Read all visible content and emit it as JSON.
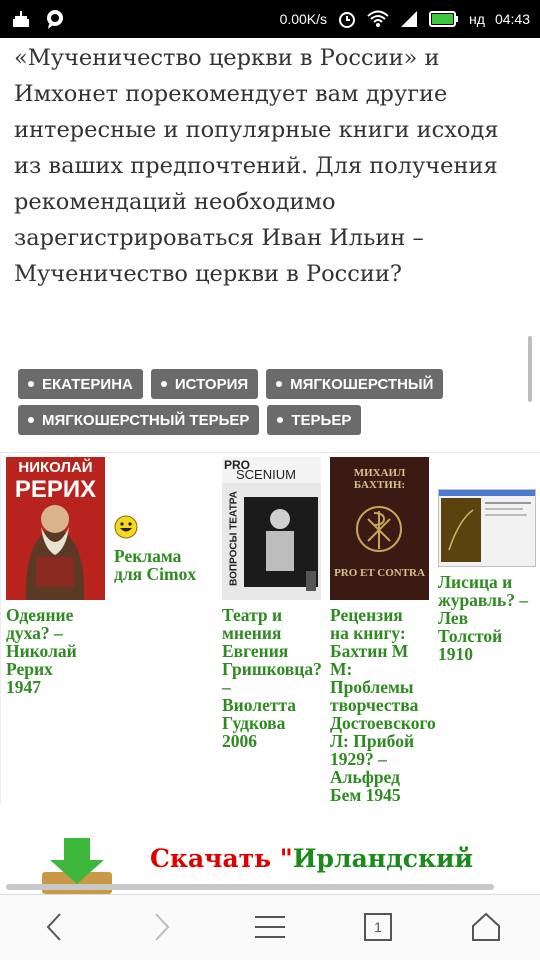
{
  "status_bar": {
    "speed": "0.00K/s",
    "day": "нд",
    "time": "04:43"
  },
  "article": {
    "lines": [
      "«Мученичество церкви в России» и",
      "Имхонет порекомендует вам другие",
      "интересные и популярные книги исходя",
      "из ваших предпочтений. Для получения",
      "рекомендаций необходимо",
      "зарегистрироваться Иван Ильин –",
      "Мученичество церкви в России?"
    ]
  },
  "tags": [
    "ЕКАТЕРИНА",
    "ИСТОРИЯ",
    "МЯГКОШЕРСТНЫЙ",
    "МЯГКОШЕРСТНЫЙ ТЕРЬЕР",
    "ТЕРЬЕР"
  ],
  "books": [
    {
      "title_lines": [
        "Одеяние",
        "духа? –",
        "Николай",
        "Рерих",
        "1947"
      ],
      "cover_text": [
        "НИКОЛАЙ",
        "РЕРИХ"
      ],
      "cover_color": "#b8231d"
    },
    {
      "title_lines": [
        "Реклама",
        "для Cimox"
      ],
      "is_ad": true
    },
    {
      "title_lines": [
        "Театр и",
        "мнения",
        "Евгения",
        "Гришковца?",
        "–",
        "Виолетта",
        "Гудкова",
        "2006"
      ],
      "cover_text": [
        "PRO",
        "SCENIUM",
        "ВОПРОСЫ ТЕАТРА"
      ],
      "cover_color": "#d9d9d9"
    },
    {
      "title_lines": [
        "Рецензия",
        "на книгу:",
        "Бахтин М",
        "М:",
        "Проблемы",
        "творчества",
        "Достоевского",
        "Л: Прибой",
        "1929? –",
        "Альфред",
        "Бем 1945"
      ],
      "cover_text": [
        "МИХАИЛ БАХТИН:",
        "PRO ET CONTRA"
      ],
      "cover_color": "#3a1a12"
    },
    {
      "title_lines": [
        "Лисица и",
        "журавль? –",
        "Лев",
        "Толстой",
        "1910"
      ],
      "cover_color": "#5b4310"
    }
  ],
  "banner": {
    "part_red": "Скачать \"",
    "part_green": "Ирландский"
  },
  "nav": {
    "tab_count": "1"
  },
  "colors": {
    "tag_bg": "#6b6b6b",
    "link_green": "#2e8b20",
    "banner_red": "#e00000"
  }
}
